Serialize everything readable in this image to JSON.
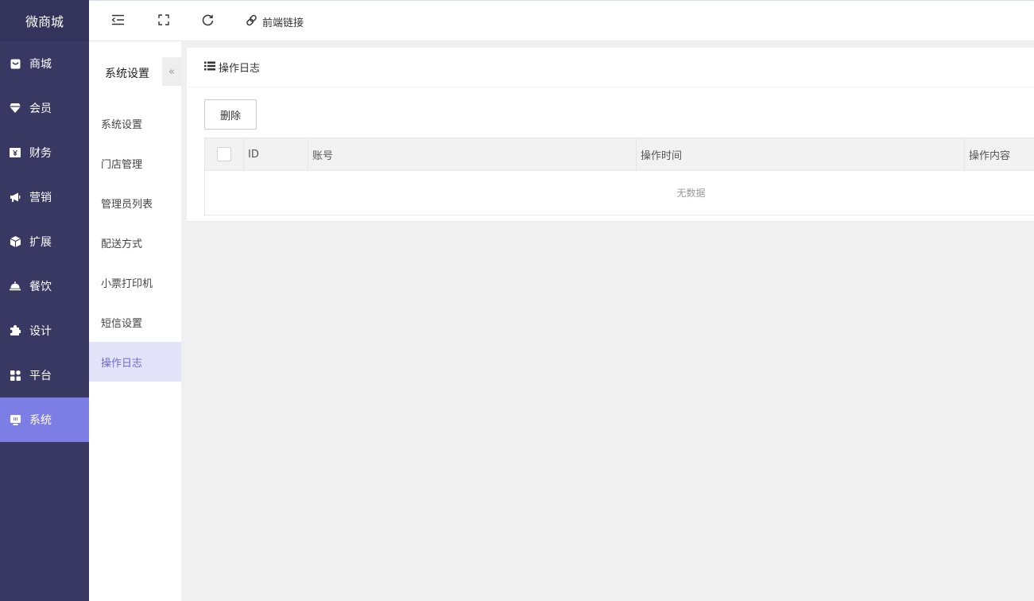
{
  "app": {
    "logo": "微商城"
  },
  "main_nav": {
    "items": [
      {
        "label": "商城",
        "icon": "store-icon"
      },
      {
        "label": "会员",
        "icon": "gem-icon"
      },
      {
        "label": "财务",
        "icon": "money-icon"
      },
      {
        "label": "营销",
        "icon": "megaphone-icon"
      },
      {
        "label": "扩展",
        "icon": "cube-icon"
      },
      {
        "label": "餐饮",
        "icon": "cloche-icon"
      },
      {
        "label": "设计",
        "icon": "puzzle-icon"
      },
      {
        "label": "平台",
        "icon": "grid-icon"
      },
      {
        "label": "系统",
        "icon": "system-icon"
      }
    ],
    "active_index": 8
  },
  "toolbar": {
    "link_label": "前端链接"
  },
  "subnav": {
    "title": "系统设置",
    "collapse_glyph": "«",
    "items": [
      {
        "label": "系统设置"
      },
      {
        "label": "门店管理"
      },
      {
        "label": "管理员列表"
      },
      {
        "label": "配送方式"
      },
      {
        "label": "小票打印机"
      },
      {
        "label": "短信设置"
      },
      {
        "label": "操作日志"
      }
    ],
    "active_index": 6
  },
  "panel": {
    "title": "操作日志",
    "delete_label": "删除",
    "columns": [
      "ID",
      "账号",
      "操作时间",
      "操作内容"
    ],
    "empty_text": "无数据"
  },
  "colors": {
    "nav_bg": "#393863",
    "nav_active": "#7d7ee5",
    "subnav_active_bg": "#e3e3fa",
    "subnav_active_text": "#6d6bd6"
  }
}
